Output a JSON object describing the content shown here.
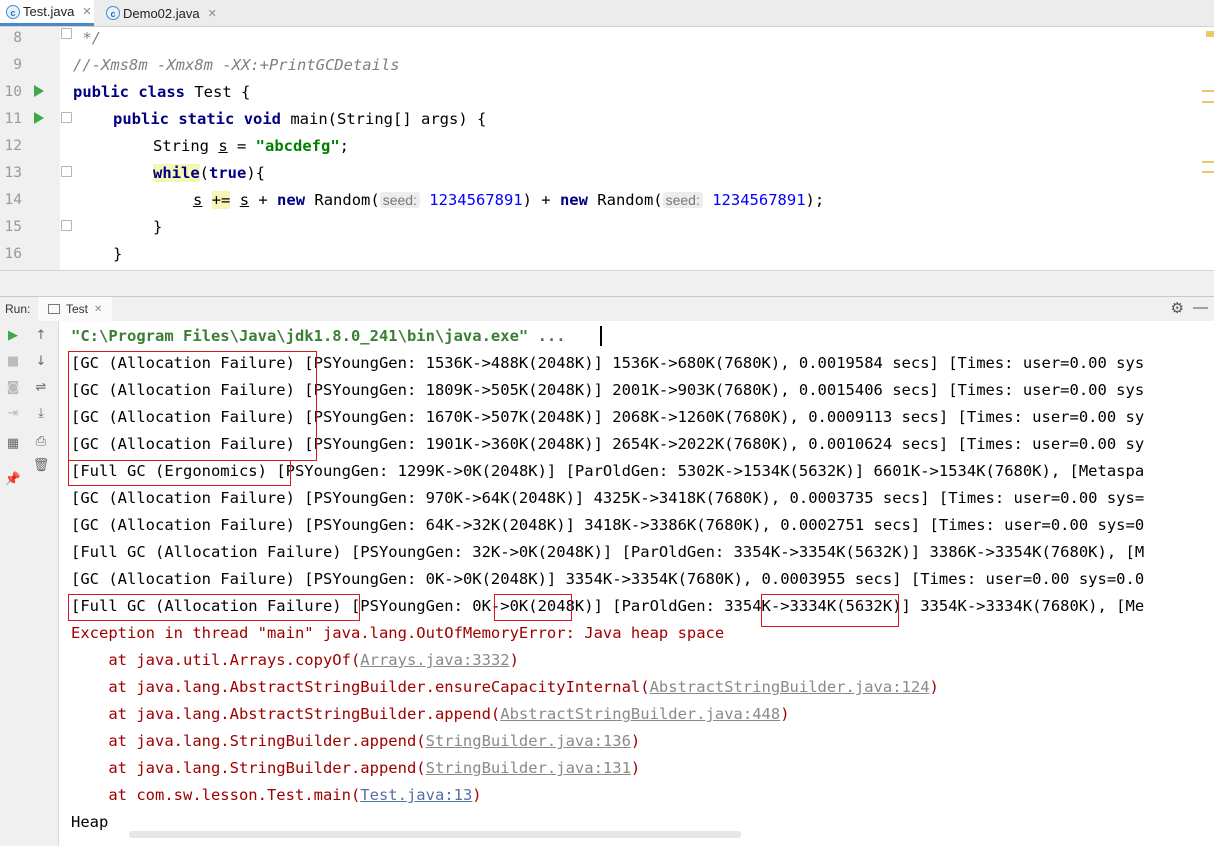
{
  "tabs": [
    {
      "label": "Test.java",
      "icon": "java-class-icon",
      "icon_letter": "c",
      "active": true
    },
    {
      "label": "Demo02.java",
      "icon": "java-class-icon",
      "icon_letter": "c",
      "active": false
    }
  ],
  "editor": {
    "lines": [
      {
        "num": "8",
        "text": " */"
      },
      {
        "num": "9",
        "text": "//-Xms8m -Xmx8m -XX:+PrintGCDetails"
      },
      {
        "num": "10",
        "kw1": "public",
        "kw2": "class",
        "rest": " Test {"
      },
      {
        "num": "11",
        "kw1": "public",
        "kw2": "static",
        "kw3": "void",
        "rest": " main(String[] args) {"
      },
      {
        "num": "12",
        "a": "String ",
        "var": "s",
        "b": " = ",
        "str": "\"abcdefg\"",
        "c": ";"
      },
      {
        "num": "13",
        "kw": "while",
        "paren_open": "(",
        "kw_true": "true",
        "paren_close": "){"
      },
      {
        "num": "14",
        "var1": "s",
        "op": "+=",
        "var2": "s",
        "plus1": " + ",
        "kw_new1": "new",
        "rand1": " Random(",
        "hint1": "seed:",
        "seed1": "1234567891",
        "mid": ") + ",
        "kw_new2": "new",
        "rand2": " Random(",
        "hint2": "seed:",
        "seed2": "1234567891",
        "end": ");"
      },
      {
        "num": "15",
        "text": "}"
      },
      {
        "num": "16",
        "text": "}"
      }
    ]
  },
  "run_panel": {
    "label": "Run:",
    "tab": "Test",
    "command": "\"C:\\Program Files\\Java\\jdk1.8.0_241\\bin\\java.exe\" ...",
    "gc_lines": [
      {
        "head": "[GC (Allocation Failure)",
        "rest": " [PSYoungGen: 1536K->488K(2048K)] 1536K->680K(7680K), 0.0019584 secs] [Times: user=0.00 sys"
      },
      {
        "head": "[GC (Allocation Failure)",
        "rest": " [PSYoungGen: 1809K->505K(2048K)] 2001K->903K(7680K), 0.0015406 secs] [Times: user=0.00 sys"
      },
      {
        "head": "[GC (Allocation Failure)",
        "rest": " [PSYoungGen: 1670K->507K(2048K)] 2068K->1260K(7680K), 0.0009113 secs] [Times: user=0.00 sy"
      },
      {
        "head": "[GC (Allocation Failure)",
        "rest": " [PSYoungGen: 1901K->360K(2048K)] 2654K->2022K(7680K), 0.0010624 secs] [Times: user=0.00 sy"
      },
      {
        "head": "[Full GC (Ergonomics) ",
        "rest": "[PSYoungGen: 1299K->0K(2048K)] [ParOldGen: 5302K->1534K(5632K)] 6601K->1534K(7680K), [Metaspa"
      },
      {
        "head": "[GC (Allocation Failure)",
        "rest": " [PSYoungGen: 970K->64K(2048K)] 4325K->3418K(7680K), 0.0003735 secs] [Times: user=0.00 sys="
      },
      {
        "head": "[GC (Allocation Failure)",
        "rest": " [PSYoungGen: 64K->32K(2048K)] 3418K->3386K(7680K), 0.0002751 secs] [Times: user=0.00 sys=0"
      },
      {
        "head": "[Full GC (Allocation Failure)",
        "rest": " [PSYoungGen: 32K->0K(2048K)] [ParOldGen: 3354K->3354K(5632K)] 3386K->3354K(7680K), [M"
      },
      {
        "head": "[GC (Allocation Failure)",
        "rest": " [PSYoungGen: 0K->0K(2048K)] 3354K->3354K(7680K), 0.0003955 secs] [Times: user=0.00 sys=0.0"
      },
      {
        "head": "[Full GC (Allocation Failure)",
        "rest": " [PSYoungGen: 0K->0K(2048K)] [ParOldGen: 3354K->3334K(5632K)] 3354K->3334K(7680K), [Me"
      }
    ],
    "exception": "Exception in thread \"main\" java.lang.OutOfMemoryError: Java heap space",
    "stack": [
      {
        "prefix": "    at java.util.Arrays.copyOf(",
        "link": "Arrays.java:3332",
        "suffix": ")"
      },
      {
        "prefix": "    at java.lang.AbstractStringBuilder.ensureCapacityInternal(",
        "link": "AbstractStringBuilder.java:124",
        "suffix": ")"
      },
      {
        "prefix": "    at java.lang.AbstractStringBuilder.append(",
        "link": "AbstractStringBuilder.java:448",
        "suffix": ")"
      },
      {
        "prefix": "    at java.lang.StringBuilder.append(",
        "link": "StringBuilder.java:136",
        "suffix": ")"
      },
      {
        "prefix": "    at java.lang.StringBuilder.append(",
        "link": "StringBuilder.java:131",
        "suffix": ")"
      },
      {
        "prefix": "    at com.sw.lesson.Test.main(",
        "link": "Test.java:13",
        "suffix": ")"
      }
    ],
    "heap": "Heap"
  },
  "colors": {
    "annotation_red": "#d8161b",
    "error_text": "#a00000",
    "keyword": "#000080",
    "string": "#008000"
  }
}
